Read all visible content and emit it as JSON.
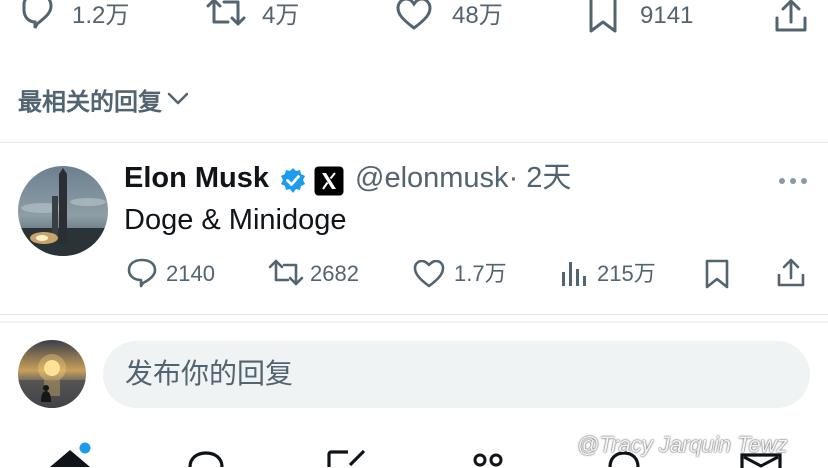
{
  "top_actions": {
    "replies": "1.2万",
    "retweets": "4万",
    "likes": "48万",
    "bookmarks": "9141"
  },
  "reply_filter": {
    "label": "最相关的回复"
  },
  "reply": {
    "author_name": "Elon Musk",
    "handle": "@elonmusk",
    "time": "· 2天",
    "text": "Doge & Minidoge",
    "stats": {
      "replies": "2140",
      "retweets": "2682",
      "likes": "1.7万",
      "views": "215万"
    }
  },
  "composer": {
    "placeholder": "发布你的回复"
  },
  "watermark": {
    "text": "@Tracy Jarquin Tewz"
  },
  "colors": {
    "text_primary": "#0f1419",
    "text_secondary": "#536471",
    "verified_blue": "#1d9bf0",
    "input_bg": "#eff3f4"
  }
}
